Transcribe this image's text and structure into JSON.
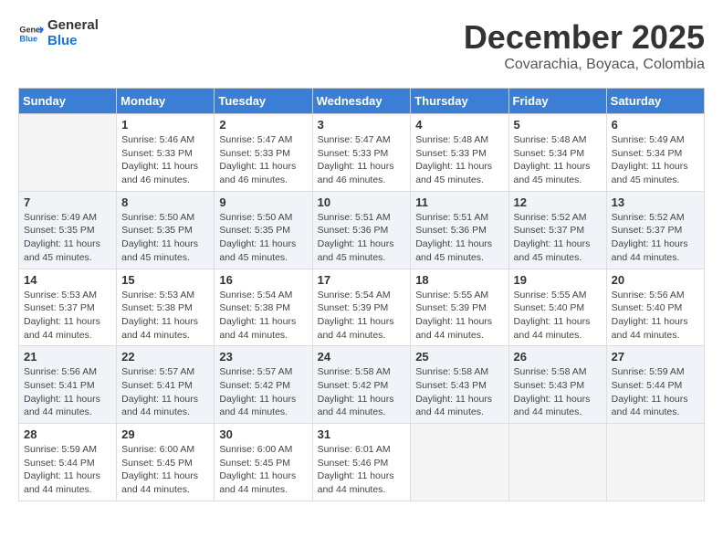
{
  "logo": {
    "line1": "General",
    "line2": "Blue"
  },
  "title": "December 2025",
  "location": "Covarachia, Boyaca, Colombia",
  "days_of_week": [
    "Sunday",
    "Monday",
    "Tuesday",
    "Wednesday",
    "Thursday",
    "Friday",
    "Saturday"
  ],
  "weeks": [
    [
      {
        "day": "",
        "info": ""
      },
      {
        "day": "1",
        "info": "Sunrise: 5:46 AM\nSunset: 5:33 PM\nDaylight: 11 hours\nand 46 minutes."
      },
      {
        "day": "2",
        "info": "Sunrise: 5:47 AM\nSunset: 5:33 PM\nDaylight: 11 hours\nand 46 minutes."
      },
      {
        "day": "3",
        "info": "Sunrise: 5:47 AM\nSunset: 5:33 PM\nDaylight: 11 hours\nand 46 minutes."
      },
      {
        "day": "4",
        "info": "Sunrise: 5:48 AM\nSunset: 5:33 PM\nDaylight: 11 hours\nand 45 minutes."
      },
      {
        "day": "5",
        "info": "Sunrise: 5:48 AM\nSunset: 5:34 PM\nDaylight: 11 hours\nand 45 minutes."
      },
      {
        "day": "6",
        "info": "Sunrise: 5:49 AM\nSunset: 5:34 PM\nDaylight: 11 hours\nand 45 minutes."
      }
    ],
    [
      {
        "day": "7",
        "info": "Sunrise: 5:49 AM\nSunset: 5:35 PM\nDaylight: 11 hours\nand 45 minutes."
      },
      {
        "day": "8",
        "info": "Sunrise: 5:50 AM\nSunset: 5:35 PM\nDaylight: 11 hours\nand 45 minutes."
      },
      {
        "day": "9",
        "info": "Sunrise: 5:50 AM\nSunset: 5:35 PM\nDaylight: 11 hours\nand 45 minutes."
      },
      {
        "day": "10",
        "info": "Sunrise: 5:51 AM\nSunset: 5:36 PM\nDaylight: 11 hours\nand 45 minutes."
      },
      {
        "day": "11",
        "info": "Sunrise: 5:51 AM\nSunset: 5:36 PM\nDaylight: 11 hours\nand 45 minutes."
      },
      {
        "day": "12",
        "info": "Sunrise: 5:52 AM\nSunset: 5:37 PM\nDaylight: 11 hours\nand 45 minutes."
      },
      {
        "day": "13",
        "info": "Sunrise: 5:52 AM\nSunset: 5:37 PM\nDaylight: 11 hours\nand 44 minutes."
      }
    ],
    [
      {
        "day": "14",
        "info": "Sunrise: 5:53 AM\nSunset: 5:37 PM\nDaylight: 11 hours\nand 44 minutes."
      },
      {
        "day": "15",
        "info": "Sunrise: 5:53 AM\nSunset: 5:38 PM\nDaylight: 11 hours\nand 44 minutes."
      },
      {
        "day": "16",
        "info": "Sunrise: 5:54 AM\nSunset: 5:38 PM\nDaylight: 11 hours\nand 44 minutes."
      },
      {
        "day": "17",
        "info": "Sunrise: 5:54 AM\nSunset: 5:39 PM\nDaylight: 11 hours\nand 44 minutes."
      },
      {
        "day": "18",
        "info": "Sunrise: 5:55 AM\nSunset: 5:39 PM\nDaylight: 11 hours\nand 44 minutes."
      },
      {
        "day": "19",
        "info": "Sunrise: 5:55 AM\nSunset: 5:40 PM\nDaylight: 11 hours\nand 44 minutes."
      },
      {
        "day": "20",
        "info": "Sunrise: 5:56 AM\nSunset: 5:40 PM\nDaylight: 11 hours\nand 44 minutes."
      }
    ],
    [
      {
        "day": "21",
        "info": "Sunrise: 5:56 AM\nSunset: 5:41 PM\nDaylight: 11 hours\nand 44 minutes."
      },
      {
        "day": "22",
        "info": "Sunrise: 5:57 AM\nSunset: 5:41 PM\nDaylight: 11 hours\nand 44 minutes."
      },
      {
        "day": "23",
        "info": "Sunrise: 5:57 AM\nSunset: 5:42 PM\nDaylight: 11 hours\nand 44 minutes."
      },
      {
        "day": "24",
        "info": "Sunrise: 5:58 AM\nSunset: 5:42 PM\nDaylight: 11 hours\nand 44 minutes."
      },
      {
        "day": "25",
        "info": "Sunrise: 5:58 AM\nSunset: 5:43 PM\nDaylight: 11 hours\nand 44 minutes."
      },
      {
        "day": "26",
        "info": "Sunrise: 5:58 AM\nSunset: 5:43 PM\nDaylight: 11 hours\nand 44 minutes."
      },
      {
        "day": "27",
        "info": "Sunrise: 5:59 AM\nSunset: 5:44 PM\nDaylight: 11 hours\nand 44 minutes."
      }
    ],
    [
      {
        "day": "28",
        "info": "Sunrise: 5:59 AM\nSunset: 5:44 PM\nDaylight: 11 hours\nand 44 minutes."
      },
      {
        "day": "29",
        "info": "Sunrise: 6:00 AM\nSunset: 5:45 PM\nDaylight: 11 hours\nand 44 minutes."
      },
      {
        "day": "30",
        "info": "Sunrise: 6:00 AM\nSunset: 5:45 PM\nDaylight: 11 hours\nand 44 minutes."
      },
      {
        "day": "31",
        "info": "Sunrise: 6:01 AM\nSunset: 5:46 PM\nDaylight: 11 hours\nand 44 minutes."
      },
      {
        "day": "",
        "info": ""
      },
      {
        "day": "",
        "info": ""
      },
      {
        "day": "",
        "info": ""
      }
    ]
  ]
}
